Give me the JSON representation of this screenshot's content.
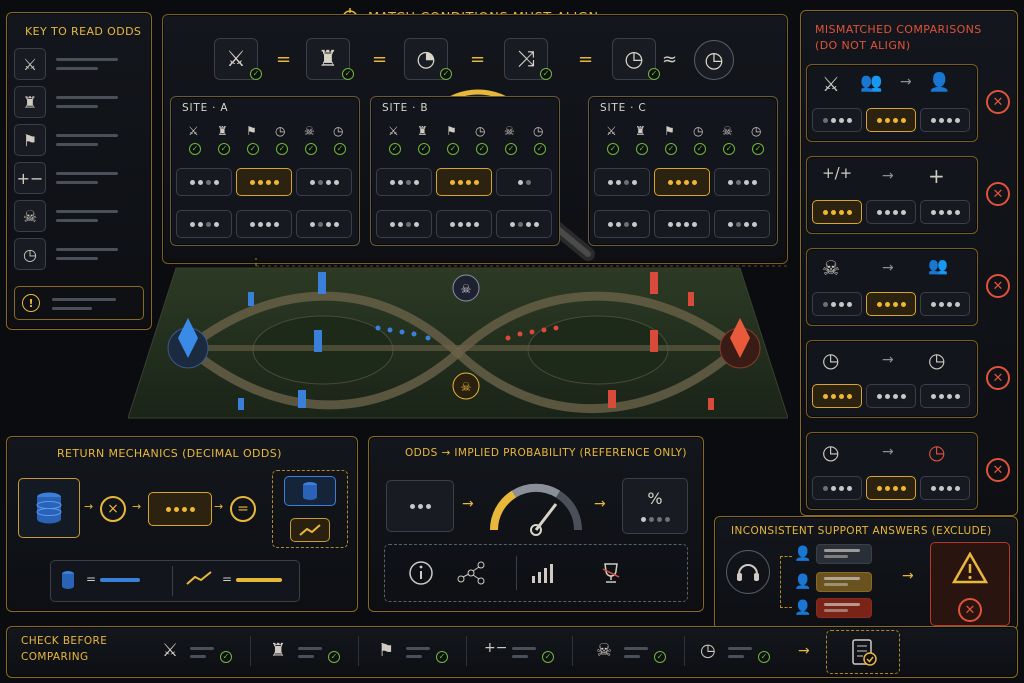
{
  "header": {
    "title": "MATCH CONDITIONS MUST ALIGN",
    "target_icon": "crosshair-icon"
  },
  "conditions": {
    "items": [
      {
        "icon": "crossed-swords-icon",
        "glyph": "⚔"
      },
      {
        "icon": "tower-icon",
        "glyph": "♜"
      },
      {
        "icon": "timer-dial-icon",
        "glyph": "◔"
      },
      {
        "icon": "arrows-cross-icon",
        "glyph": "⤨"
      },
      {
        "icon": "stopwatch-icon",
        "glyph": "◷"
      }
    ],
    "separators": [
      "=",
      "=",
      "=",
      "=",
      "≈"
    ],
    "last_icon": {
      "icon": "clock-icon",
      "glyph": "◷"
    }
  },
  "key": {
    "title": "KEY TO READ ODDS",
    "rows": [
      {
        "icon": "crossed-swords-icon",
        "glyph": "⚔"
      },
      {
        "icon": "tower-icon",
        "glyph": "♜"
      },
      {
        "icon": "flag-icon",
        "glyph": "⚑"
      },
      {
        "icon": "plus-minus-icon",
        "glyph": "+−"
      },
      {
        "icon": "skull-icon",
        "glyph": "☠"
      },
      {
        "icon": "clock-icon",
        "glyph": "◷"
      }
    ],
    "note_icon": "exclamation-icon"
  },
  "sites": [
    {
      "label": "SITE · A",
      "name": "SITE",
      "letter": "A"
    },
    {
      "label": "SITE · B",
      "name": "SITE",
      "letter": "B"
    },
    {
      "label": "SITE · C",
      "name": "SITE",
      "letter": "C"
    }
  ],
  "site_header_icons": [
    "⚔",
    "♜",
    "⚑",
    "◷",
    "☠",
    "◷"
  ],
  "mismatched": {
    "title_line1": "MISMATCHED COMPARISONS",
    "title_line2": "(DO NOT ALIGN)",
    "rows": [
      {
        "left": "⚔",
        "mid": "group-icon",
        "right": "person-icon"
      },
      {
        "left": "+/+",
        "right": "+"
      },
      {
        "left": "☠",
        "right": "group-icon"
      },
      {
        "left": "◷",
        "right": "◷"
      },
      {
        "left": "◷",
        "right": "◷"
      }
    ]
  },
  "returns": {
    "title": "RETURN MECHANICS (DECIMAL ODDS)",
    "ops": [
      "×",
      "="
    ],
    "legend": [
      "=",
      "="
    ]
  },
  "odds_prob": {
    "title": "ODDS → IMPLIED PROBABILITY (REFERENCE ONLY)",
    "percent": "%",
    "icons": [
      "info-icon",
      "network-icon",
      "chart-bars-icon",
      "trophy-icon"
    ]
  },
  "support": {
    "title": "INCONSISTENT SUPPORT ANSWERS (EXCLUDE)"
  },
  "check": {
    "line1": "CHECK BEFORE",
    "line2": "COMPARING",
    "items": [
      "⚔",
      "♜",
      "⚑",
      "+−",
      "☠",
      "◷"
    ]
  },
  "colors": {
    "accent": "#e8b83a",
    "danger": "#e0533a",
    "ok": "#6fb83a",
    "blue_team": "#3a7fd8",
    "red_team": "#d84a3a"
  }
}
